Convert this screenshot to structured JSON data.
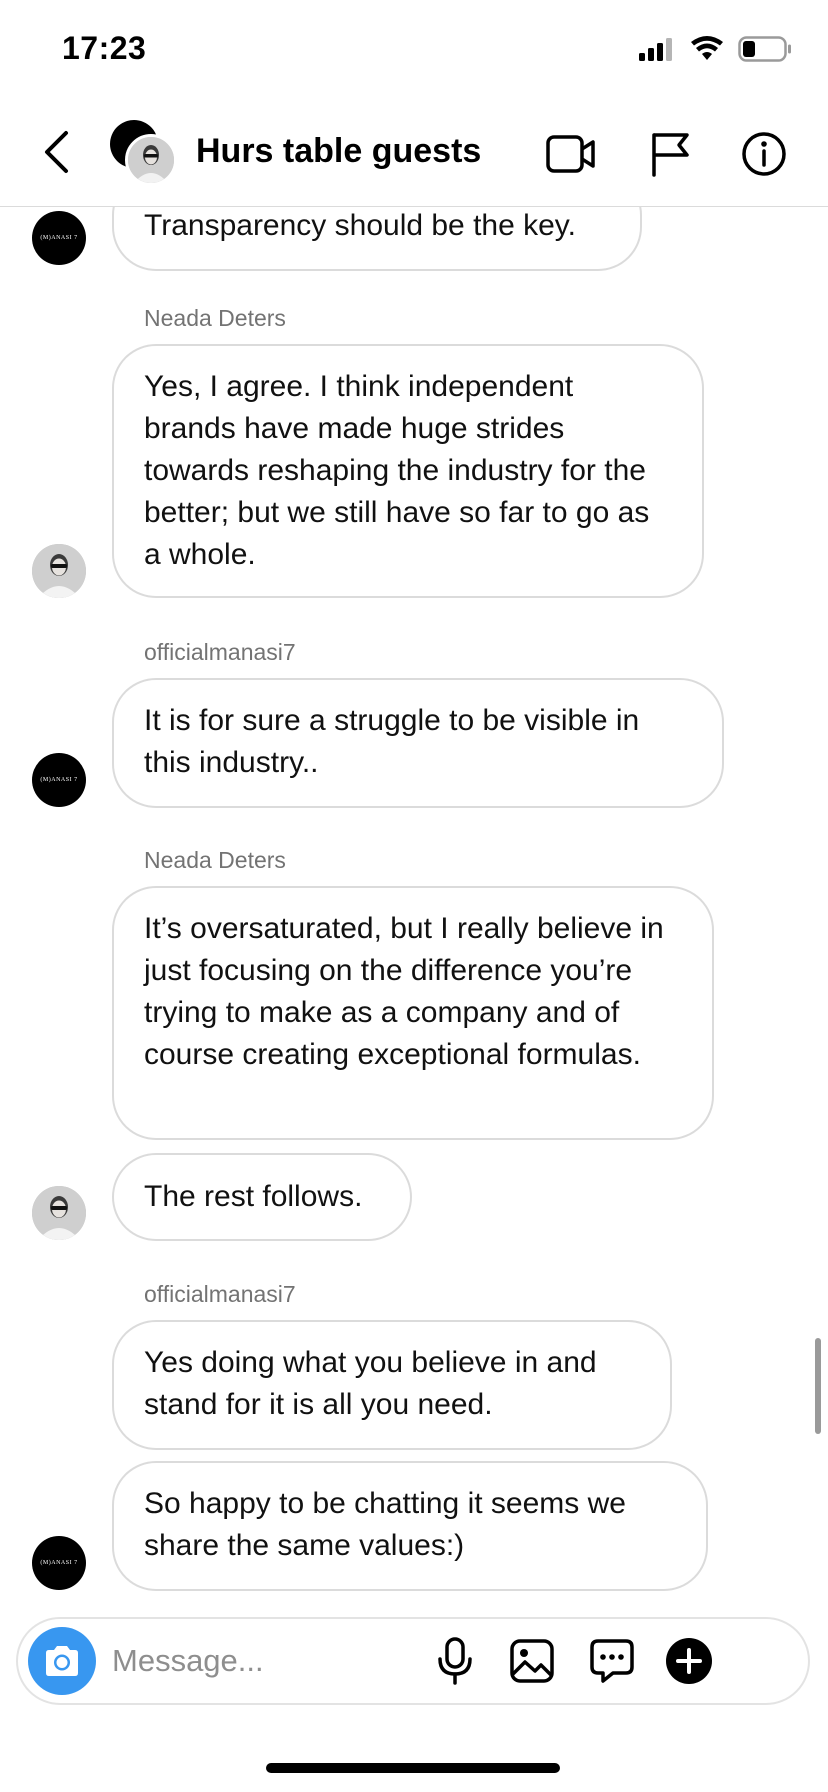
{
  "status_bar": {
    "time": "17:23",
    "icons": [
      "cellular-signal-icon",
      "wifi-icon",
      "battery-icon"
    ]
  },
  "header": {
    "title": "Hurs table guests",
    "icons": [
      "back-icon",
      "video-call-icon",
      "flag-icon",
      "info-icon"
    ]
  },
  "messages": [
    {
      "sender": "",
      "text": "Transparency should be the key.",
      "avatar": "officialmanasi7"
    },
    {
      "sender": "Neada Deters",
      "text": "Yes, I agree. I think independent brands have made huge strides towards reshaping the industry for the better; but we still have so far to go as a whole.",
      "avatar": "Neada Deters"
    },
    {
      "sender": "officialmanasi7",
      "text": "It is for sure a struggle to be visible in this industry..",
      "avatar": "officialmanasi7"
    },
    {
      "sender": "Neada Deters",
      "text": "It’s oversaturated, but I really believe in just focusing on the difference you’re trying to make as a company and of course creating exceptional formulas.",
      "avatar": ""
    },
    {
      "sender": "",
      "text": "The rest follows.",
      "avatar": "Neada Deters"
    },
    {
      "sender": "officialmanasi7",
      "text": "Yes doing what you believe in and stand for it is all you need.",
      "avatar": ""
    },
    {
      "sender": "",
      "text": "So happy to be chatting it seems we share the same values:)",
      "avatar": "officialmanasi7"
    }
  ],
  "brand_avatar_text": "(M)ANASI 7",
  "composer": {
    "placeholder": "Message...",
    "value": "",
    "icons": [
      "camera-icon",
      "microphone-icon",
      "gallery-icon",
      "sticker-icon",
      "plus-icon"
    ]
  },
  "colors": {
    "accent": "#3897f0",
    "bubble_border": "#dbdbdb",
    "sender_name": "#737373",
    "text": "#111111"
  }
}
